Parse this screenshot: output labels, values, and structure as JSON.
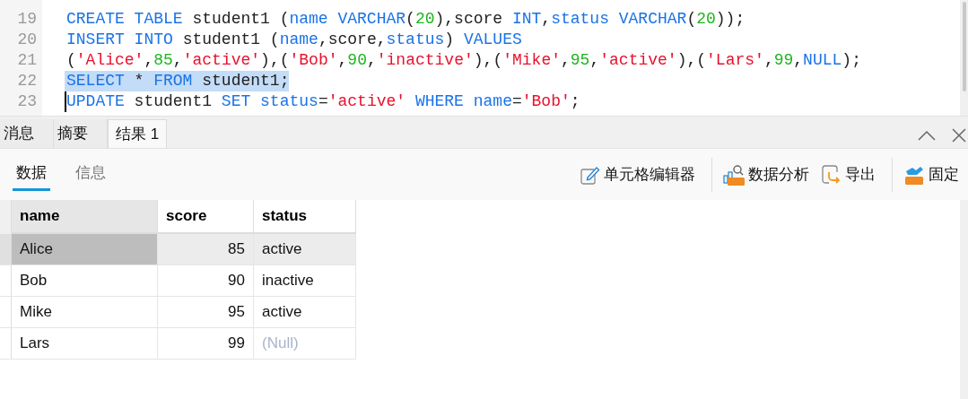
{
  "editor": {
    "lines": [
      {
        "number": "19",
        "selected": false,
        "cursor": false,
        "tokens": [
          {
            "kind": "keyword",
            "text": "CREATE TABLE"
          },
          {
            "kind": "plain",
            "text": " student1 ("
          },
          {
            "kind": "keyword",
            "text": "name VARCHAR"
          },
          {
            "kind": "plain",
            "text": "("
          },
          {
            "kind": "number",
            "text": "20"
          },
          {
            "kind": "plain",
            "text": "),score "
          },
          {
            "kind": "keyword",
            "text": "INT"
          },
          {
            "kind": "plain",
            "text": ","
          },
          {
            "kind": "keyword",
            "text": "status VARCHAR"
          },
          {
            "kind": "plain",
            "text": "("
          },
          {
            "kind": "number",
            "text": "20"
          },
          {
            "kind": "plain",
            "text": "));"
          }
        ]
      },
      {
        "number": "20",
        "selected": false,
        "cursor": false,
        "tokens": [
          {
            "kind": "keyword",
            "text": "INSERT INTO"
          },
          {
            "kind": "plain",
            "text": " student1 ("
          },
          {
            "kind": "keyword",
            "text": "name"
          },
          {
            "kind": "plain",
            "text": ",score,"
          },
          {
            "kind": "keyword",
            "text": "status"
          },
          {
            "kind": "plain",
            "text": ") "
          },
          {
            "kind": "keyword",
            "text": "VALUES"
          }
        ]
      },
      {
        "number": "21",
        "selected": false,
        "cursor": false,
        "tokens": [
          {
            "kind": "plain",
            "text": "("
          },
          {
            "kind": "string",
            "text": "'Alice'"
          },
          {
            "kind": "plain",
            "text": ","
          },
          {
            "kind": "number",
            "text": "85"
          },
          {
            "kind": "plain",
            "text": ","
          },
          {
            "kind": "string",
            "text": "'active'"
          },
          {
            "kind": "plain",
            "text": "),("
          },
          {
            "kind": "string",
            "text": "'Bob'"
          },
          {
            "kind": "plain",
            "text": ","
          },
          {
            "kind": "number",
            "text": "90"
          },
          {
            "kind": "plain",
            "text": ","
          },
          {
            "kind": "string",
            "text": "'inactive'"
          },
          {
            "kind": "plain",
            "text": "),("
          },
          {
            "kind": "string",
            "text": "'Mike'"
          },
          {
            "kind": "plain",
            "text": ","
          },
          {
            "kind": "number",
            "text": "95"
          },
          {
            "kind": "plain",
            "text": ","
          },
          {
            "kind": "string",
            "text": "'active'"
          },
          {
            "kind": "plain",
            "text": "),("
          },
          {
            "kind": "string",
            "text": "'Lars'"
          },
          {
            "kind": "plain",
            "text": ","
          },
          {
            "kind": "number",
            "text": "99"
          },
          {
            "kind": "plain",
            "text": ","
          },
          {
            "kind": "keyword",
            "text": "NULL"
          },
          {
            "kind": "plain",
            "text": ");"
          }
        ]
      },
      {
        "number": "22",
        "selected": true,
        "cursor": false,
        "tokens": [
          {
            "kind": "keyword",
            "text": "SELECT"
          },
          {
            "kind": "plain",
            "text": " * "
          },
          {
            "kind": "keyword",
            "text": "FROM"
          },
          {
            "kind": "plain",
            "text": " student1;"
          }
        ]
      },
      {
        "number": "23",
        "selected": false,
        "cursor": true,
        "tokens": [
          {
            "kind": "keyword",
            "text": "UPDATE"
          },
          {
            "kind": "plain",
            "text": " student1 "
          },
          {
            "kind": "keyword",
            "text": "SET status"
          },
          {
            "kind": "plain",
            "text": "="
          },
          {
            "kind": "string",
            "text": "'active'"
          },
          {
            "kind": "keyword",
            "text": " WHERE name"
          },
          {
            "kind": "plain",
            "text": "="
          },
          {
            "kind": "string",
            "text": "'Bob'"
          },
          {
            "kind": "plain",
            "text": ";"
          }
        ]
      }
    ]
  },
  "result_tabs": [
    {
      "label": "消息",
      "selected": false
    },
    {
      "label": "摘要",
      "selected": false
    },
    {
      "label": "结果 1",
      "selected": true
    }
  ],
  "sub_tabs": [
    {
      "label": "数据",
      "selected": true
    },
    {
      "label": "信息",
      "selected": false
    }
  ],
  "toolbar": [
    {
      "kind": "edit",
      "label": "单元格编辑器"
    },
    {
      "kind": "analysis",
      "label": "数据分析"
    },
    {
      "kind": "export",
      "label": "导出"
    },
    {
      "kind": "pin",
      "label": "固定"
    }
  ],
  "table": {
    "columns": [
      {
        "label": "name",
        "selected": true
      },
      {
        "label": "score",
        "selected": false
      },
      {
        "label": "status",
        "selected": false
      }
    ],
    "rows": [
      {
        "selected": true,
        "cells": [
          {
            "kind": "text",
            "text": "Alice"
          },
          {
            "kind": "number",
            "text": "85"
          },
          {
            "kind": "text",
            "text": "active"
          }
        ]
      },
      {
        "selected": false,
        "cells": [
          {
            "kind": "text",
            "text": "Bob"
          },
          {
            "kind": "number",
            "text": "90"
          },
          {
            "kind": "text",
            "text": "inactive"
          }
        ]
      },
      {
        "selected": false,
        "cells": [
          {
            "kind": "text",
            "text": "Mike"
          },
          {
            "kind": "number",
            "text": "95"
          },
          {
            "kind": "text",
            "text": "active"
          }
        ]
      },
      {
        "selected": false,
        "cells": [
          {
            "kind": "text",
            "text": "Lars"
          },
          {
            "kind": "number",
            "text": "99"
          },
          {
            "kind": "null",
            "text": "(Null)"
          }
        ]
      }
    ]
  }
}
